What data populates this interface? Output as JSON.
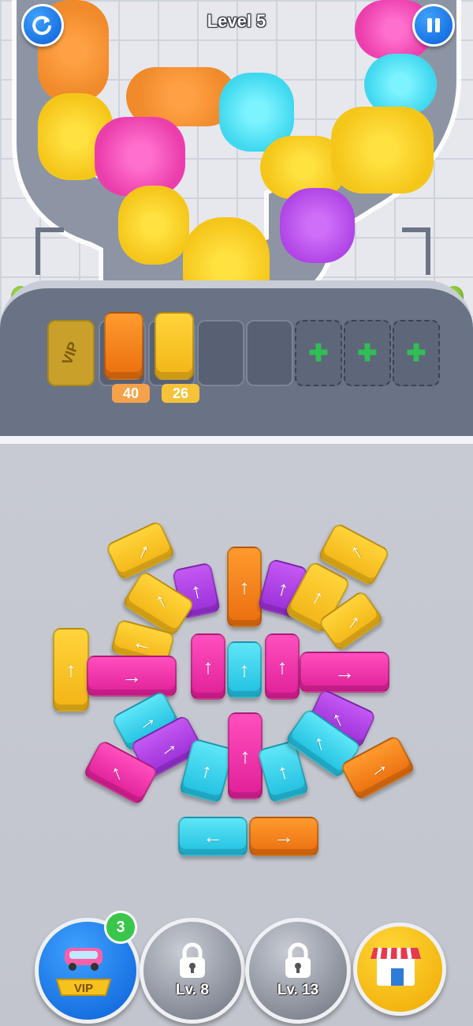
{
  "header": {
    "title": "Level 5"
  },
  "top_buttons": {
    "restart_icon": "restart-icon",
    "pause_icon": "pause-icon"
  },
  "dock": {
    "vip_slot_label": "VIP",
    "parked_buses": [
      {
        "color": "#f07a14",
        "count": "40"
      },
      {
        "color": "#f2b71c",
        "count": "26"
      }
    ],
    "empty_slots": 2,
    "locked_slots": 3
  },
  "buses": {
    "arrow_up": "↑",
    "arrow_right": "→",
    "arrow_left": "←"
  },
  "bottom_bar": {
    "vip_label": "VIP",
    "vip_badge": "3",
    "lock1_label": "Lv. 8",
    "lock2_label": "Lv. 13",
    "shop_icon": "shop-icon"
  },
  "colors": {
    "yellow": "#f5bd1f",
    "orange": "#f07a14",
    "pink": "#e62aa3",
    "purple": "#a338dc",
    "cyan": "#2fcbe8",
    "accent_blue": "#1479ea",
    "add_green": "#2fbf55"
  }
}
